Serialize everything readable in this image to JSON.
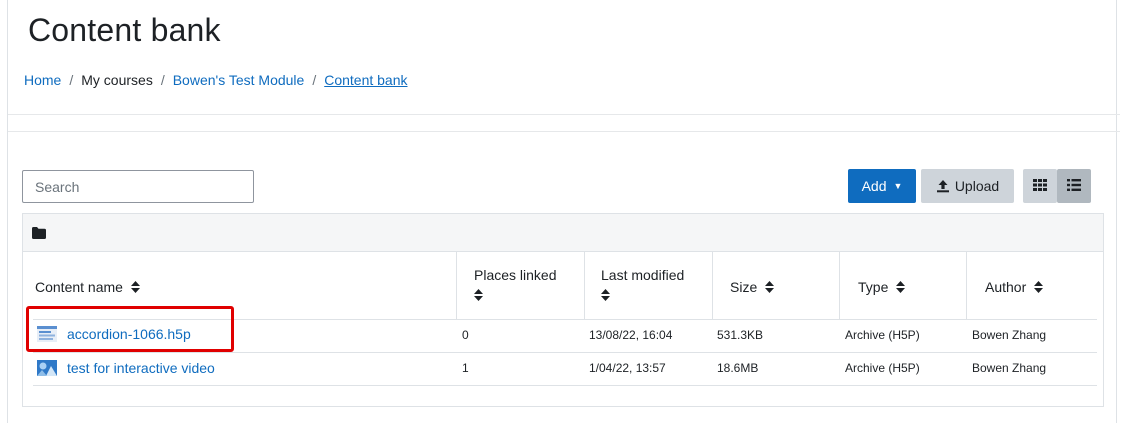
{
  "page": {
    "title": "Content bank"
  },
  "breadcrumb": [
    {
      "label": "Home"
    },
    {
      "label": "My courses"
    },
    {
      "label": "Bowen's Test Module"
    },
    {
      "label": "Content bank"
    }
  ],
  "toolbar": {
    "search_placeholder": "Search",
    "add_label": "Add",
    "upload_label": "Upload"
  },
  "table": {
    "columns": [
      "Content name",
      "Places linked",
      "Last modified",
      "Size",
      "Type",
      "Author"
    ],
    "rows": [
      {
        "name": "accordion-1066.h5p",
        "icon": "document-icon",
        "places_linked": "0",
        "last_modified": "13/08/22, 16:04",
        "size": "531.3KB",
        "type": "Archive (H5P)",
        "author": "Bowen Zhang"
      },
      {
        "name": "test for interactive video",
        "icon": "interactive-video-icon",
        "places_linked": "1",
        "last_modified": "1/04/22, 13:57",
        "size": "18.6MB",
        "type": "Archive (H5P)",
        "author": "Bowen Zhang"
      }
    ]
  },
  "colors": {
    "accent": "#0f6cbf",
    "highlight": "#e00000"
  }
}
